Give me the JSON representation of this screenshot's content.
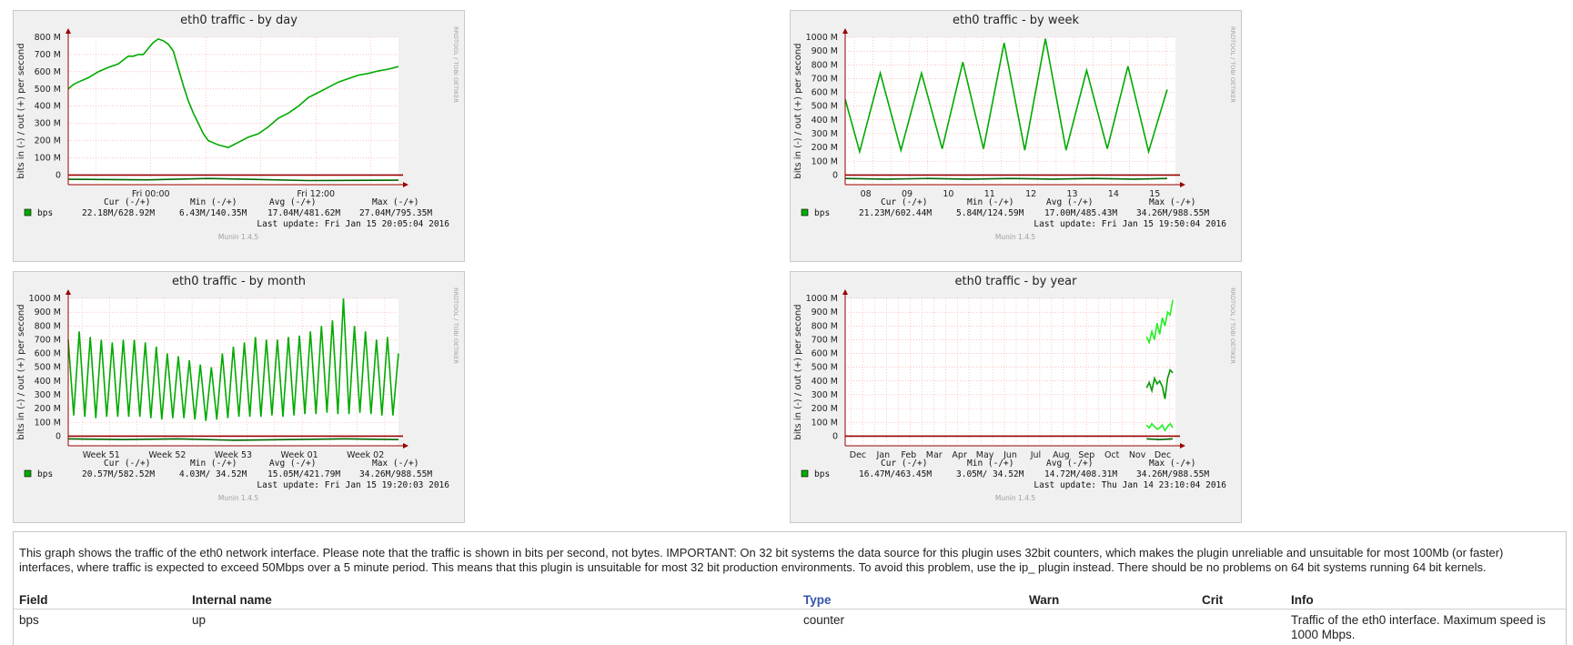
{
  "chart_data": [
    {
      "type": "line",
      "title": "eth0 traffic - by day",
      "ylabel": "bits in (-) / out (+) per second",
      "ylim": [
        0,
        800000000
      ],
      "yticks": [
        "800 M",
        "700 M",
        "600 M",
        "500 M",
        "400 M",
        "300 M",
        "200 M",
        "100 M",
        "0"
      ],
      "xticks": [
        "Fri 00:00",
        "Fri 12:00"
      ],
      "grid": true,
      "series": [
        {
          "name": "bps",
          "color": "#00aa00",
          "role": "out",
          "x": [
            0,
            0.5,
            1,
            2,
            3,
            4,
            5,
            6,
            6.5,
            7,
            7.5,
            8,
            8.5,
            9,
            9.5,
            10,
            10.5,
            11,
            11.5,
            12,
            12.5,
            13,
            13.5,
            14,
            15,
            16,
            17,
            18,
            19,
            20,
            21,
            22,
            23,
            24,
            25,
            26,
            27,
            28,
            29,
            30,
            31,
            32,
            33
          ],
          "values": [
            500,
            525,
            540,
            565,
            600,
            625,
            645,
            690,
            690,
            700,
            700,
            735,
            770,
            790,
            780,
            760,
            720,
            620,
            520,
            430,
            360,
            300,
            240,
            200,
            175,
            160,
            190,
            220,
            240,
            280,
            330,
            360,
            400,
            450,
            480,
            510,
            540,
            560,
            580,
            590,
            605,
            615,
            630
          ]
        },
        {
          "name": "bps",
          "color": "#006600",
          "role": "in",
          "x": [
            0,
            8,
            14,
            18,
            24,
            33
          ],
          "values": [
            -25,
            -28,
            -20,
            -25,
            -32,
            -30
          ]
        }
      ],
      "legend": [
        {
          "name": "bps",
          "cur": "22.18M/628.92M",
          "min": "6.43M/140.35M",
          "avg": "17.04M/481.62M",
          "max": "27.04M/795.35M"
        }
      ],
      "last_update": "Last update: Fri Jan 15 20:05:04 2016",
      "footer": "Munin 1.4.5",
      "watermark": "RRDTOOL / TOBI OETIKER"
    },
    {
      "type": "line",
      "title": "eth0 traffic - by week",
      "ylabel": "bits in (-) / out (+) per second",
      "ylim": [
        0,
        1000000000
      ],
      "yticks": [
        "1000 M",
        "900 M",
        "800 M",
        "700 M",
        "600 M",
        "500 M",
        "400 M",
        "300 M",
        "200 M",
        "100 M",
        "0"
      ],
      "xticks": [
        "08",
        "09",
        "10",
        "11",
        "12",
        "13",
        "14",
        "15"
      ],
      "grid": true,
      "series": [
        {
          "name": "bps",
          "color": "#00aa00",
          "role": "out",
          "x": [
            0,
            0.35,
            0.85,
            1.35,
            1.85,
            2.35,
            2.85,
            3.35,
            3.85,
            4.35,
            4.85,
            5.35,
            5.85,
            6.35,
            6.85,
            7.35,
            7.8
          ],
          "values": [
            550,
            170,
            740,
            180,
            740,
            190,
            820,
            190,
            960,
            180,
            990,
            180,
            760,
            190,
            790,
            170,
            620
          ]
        },
        {
          "name": "bps",
          "color": "#006600",
          "role": "in",
          "x": [
            0,
            1,
            2,
            3,
            4,
            5,
            6,
            7,
            7.8
          ],
          "values": [
            -25,
            -30,
            -25,
            -30,
            -25,
            -30,
            -25,
            -30,
            -25
          ]
        }
      ],
      "legend": [
        {
          "name": "bps",
          "cur": "21.23M/602.44M",
          "min": "5.84M/124.59M",
          "avg": "17.00M/485.43M",
          "max": "34.26M/988.55M"
        }
      ],
      "last_update": "Last update: Fri Jan 15 19:50:04 2016",
      "footer": "Munin 1.4.5",
      "watermark": "RRDTOOL / TOBI OETIKER"
    },
    {
      "type": "line",
      "title": "eth0 traffic - by month",
      "ylabel": "bits in (-) / out (+) per second",
      "ylim": [
        0,
        1000000000
      ],
      "yticks": [
        "1000 M",
        "900 M",
        "800 M",
        "700 M",
        "600 M",
        "500 M",
        "400 M",
        "300 M",
        "200 M",
        "100 M",
        "0"
      ],
      "xticks": [
        "Week 51",
        "Week 52",
        "Week 53",
        "Week 01",
        "Week 02"
      ],
      "grid": true,
      "series": [
        {
          "name": "bps",
          "color": "#00aa00",
          "role": "out",
          "x": [
            0,
            0.5,
            1,
            1.5,
            2,
            2.5,
            3,
            3.5,
            4,
            4.5,
            5,
            5.5,
            6,
            6.5,
            7,
            7.5,
            8,
            8.5,
            9,
            9.5,
            10,
            10.5,
            11,
            11.5,
            12,
            12.5,
            13,
            13.5,
            14,
            14.5,
            15,
            15.5,
            16,
            16.5,
            17,
            17.5,
            18,
            18.5,
            19,
            19.5,
            20,
            20.5,
            21,
            21.5,
            22,
            22.5,
            23,
            23.5,
            24,
            24.5,
            25,
            25.5,
            26,
            26.5,
            27,
            27.5,
            28,
            28.5,
            29,
            29.5,
            30
          ],
          "values": [
            700,
            150,
            760,
            140,
            720,
            130,
            700,
            140,
            680,
            140,
            700,
            140,
            700,
            140,
            680,
            130,
            650,
            120,
            600,
            130,
            580,
            130,
            550,
            120,
            520,
            110,
            500,
            120,
            600,
            130,
            650,
            140,
            680,
            140,
            720,
            140,
            700,
            150,
            700,
            140,
            720,
            150,
            730,
            160,
            760,
            160,
            800,
            170,
            840,
            160,
            1000,
            160,
            800,
            170,
            760,
            160,
            700,
            150,
            720,
            150,
            600
          ]
        },
        {
          "name": "bps",
          "color": "#006600",
          "role": "in",
          "x": [
            0,
            5,
            10,
            15,
            20,
            25,
            30
          ],
          "values": [
            -20,
            -25,
            -20,
            -30,
            -25,
            -20,
            -25
          ]
        }
      ],
      "legend": [
        {
          "name": "bps",
          "cur": "20.57M/582.52M",
          "min": "4.03M/ 34.52M",
          "avg": "15.05M/421.79M",
          "max": "34.26M/988.55M"
        }
      ],
      "last_update": "Last update: Fri Jan 15 19:20:03 2016",
      "footer": "Munin 1.4.5",
      "watermark": "RRDTOOL / TOBI OETIKER"
    },
    {
      "type": "line",
      "title": "eth0 traffic - by year",
      "ylabel": "bits in (-) / out (+) per second",
      "ylim": [
        0,
        1000000000
      ],
      "yticks": [
        "1000 M",
        "900 M",
        "800 M",
        "700 M",
        "600 M",
        "500 M",
        "400 M",
        "300 M",
        "200 M",
        "100 M",
        "0"
      ],
      "xticks": [
        "Dec",
        "Jan",
        "Feb",
        "Mar",
        "Apr",
        "May",
        "Jun",
        "Jul",
        "Aug",
        "Sep",
        "Oct",
        "Nov",
        "Dec"
      ],
      "grid": true,
      "series": [
        {
          "name": "bps",
          "color": "#22ee22",
          "role": "out-max-band",
          "x": [
            11.5,
            11.6,
            11.7,
            11.8,
            11.9,
            12.0,
            12.1,
            12.2,
            12.3,
            12.4,
            12.5
          ],
          "values": [
            720,
            680,
            760,
            700,
            820,
            740,
            860,
            800,
            900,
            880,
            990
          ]
        },
        {
          "name": "bps",
          "color": "#22ee22",
          "role": "out-min-band",
          "x": [
            11.5,
            11.6,
            11.7,
            11.8,
            11.9,
            12.0,
            12.1,
            12.2,
            12.3,
            12.4,
            12.5
          ],
          "values": [
            80,
            60,
            90,
            70,
            50,
            60,
            80,
            40,
            70,
            90,
            60
          ]
        },
        {
          "name": "bps",
          "color": "#009900",
          "role": "out-avg",
          "x": [
            11.5,
            11.6,
            11.7,
            11.8,
            11.9,
            12.0,
            12.1,
            12.2,
            12.3,
            12.4,
            12.5
          ],
          "values": [
            350,
            390,
            330,
            420,
            380,
            400,
            360,
            270,
            420,
            480,
            460
          ]
        },
        {
          "name": "bps",
          "color": "#006600",
          "role": "in",
          "x": [
            11.5,
            12.0,
            12.5
          ],
          "values": [
            -20,
            -25,
            -20
          ]
        }
      ],
      "legend": [
        {
          "name": "bps",
          "cur": "16.47M/463.45M",
          "min": "3.05M/ 34.52M",
          "avg": "14.72M/408.31M",
          "max": "34.26M/988.55M"
        }
      ],
      "last_update": "Last update: Thu Jan 14 23:10:04 2016",
      "footer": "Munin 1.4.5",
      "watermark": "RRDTOOL / TOBI OETIKER"
    }
  ],
  "legend_headers": {
    "cur": "Cur (-/+)",
    "min": "Min (-/+)",
    "avg": "Avg (-/+)",
    "max": "Max (-/+)"
  },
  "colors": {
    "frame_bg": "#f0f0f0",
    "grid_major": "#ff9999",
    "grid_minor": "#e0e0e0",
    "axis": "#990000",
    "line": "#00aa00"
  },
  "description": "This graph shows the traffic of the eth0 network interface. Please note that the traffic is shown in bits per second, not bytes. IMPORTANT: On 32 bit systems the data source for this plugin uses 32bit counters, which makes the plugin unreliable and unsuitable for most 100Mb (or faster) interfaces, where traffic is expected to exceed 50Mbps over a 5 minute period. This means that this plugin is unsuitable for most 32 bit production environments. To avoid this problem, use the ip_ plugin instead. There should be no problems on 64 bit systems running 64 bit kernels.",
  "table": {
    "headers": {
      "field": "Field",
      "internal": "Internal name",
      "type": "Type",
      "warn": "Warn",
      "crit": "Crit",
      "info": "Info"
    },
    "rows": [
      {
        "field": "bps",
        "internal": "up",
        "type": "counter",
        "warn": "",
        "crit": "",
        "info": "Traffic of the eth0 interface. Maximum speed is 1000 Mbps."
      }
    ]
  }
}
